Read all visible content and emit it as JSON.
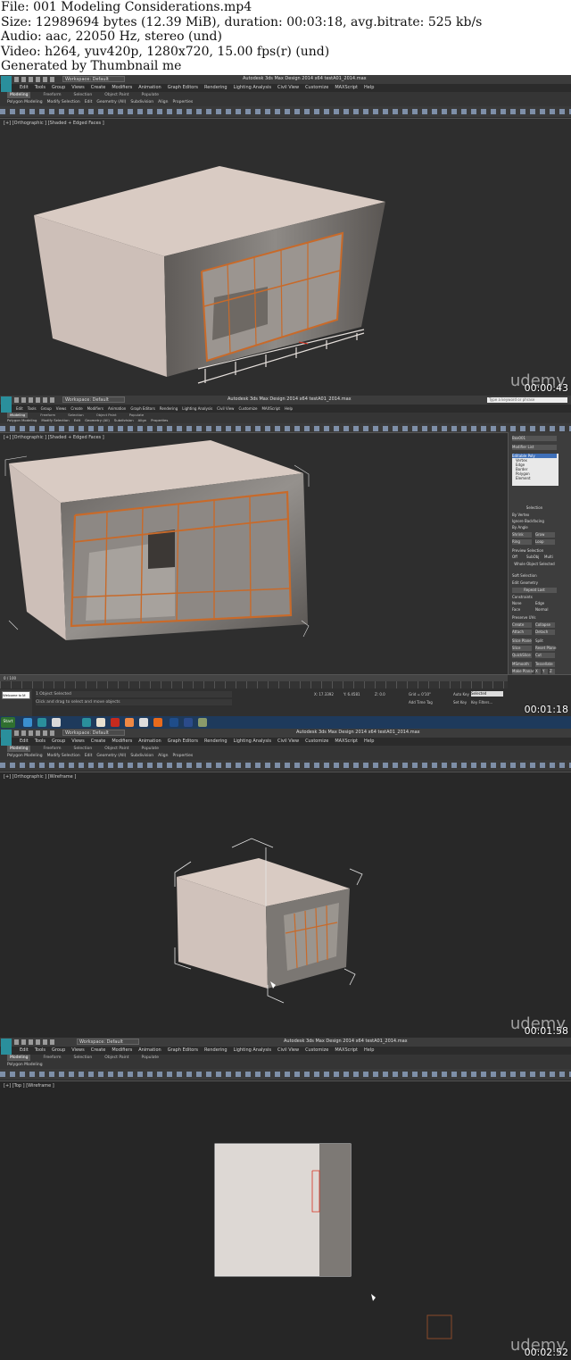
{
  "header": {
    "lines": [
      "File: 001 Modeling Considerations.mp4",
      "Size: 12989694 bytes (12.39 MiB), duration: 00:03:18, avg.bitrate: 525 kb/s",
      "Audio: aac, 22050 Hz, stereo (und)",
      "Video: h264, yuv420p, 1280x720, 15.00 fps(r) (und)",
      "Generated by Thumbnail me"
    ]
  },
  "app": {
    "title": "Autodesk 3ds Max Design 2014 x64     testA01_2014.max",
    "workspace": "Workspace: Default",
    "search_placeholder": "Type a keyword or phrase",
    "menu": [
      "Edit",
      "Tools",
      "Group",
      "Views",
      "Create",
      "Modifiers",
      "Animation",
      "Graph Editors",
      "Rendering",
      "Lighting Analysis",
      "Civil View",
      "Customize",
      "MAXScript",
      "Help"
    ],
    "ribbon_tabs": [
      "Modeling",
      "Freeform",
      "Selection",
      "Object Paint",
      "Populate"
    ],
    "ribbon_sub": [
      "Polygon Modeling",
      "Modify Selection",
      "Edit",
      "Geometry (All)",
      "Subdivision",
      "Align",
      "Properties"
    ],
    "ribbon_sub_short": [
      "Polygon Modeling"
    ],
    "layer": "walls F",
    "selection_set": "Create Selection Se",
    "view_dropdown": "View",
    "filter_dropdown": "All"
  },
  "frames": [
    {
      "viewport_label": "[+] [Orthographic ] [Shaded + Edged Faces ]",
      "timestamp": "00:00:43",
      "watermark": "udemy"
    },
    {
      "viewport_label": "[+] [Orthographic ] [Shaded + Edged Faces ]",
      "timestamp": "00:01:18",
      "watermark": "udemy",
      "command_panel": {
        "object_name": "Box001",
        "modifier_list": "Modifier List",
        "stack": [
          "Editable Poly",
          "Vertex",
          "Edge",
          "Border",
          "Polygon",
          "Element"
        ],
        "rollouts": [
          "Selection",
          "By Vertex",
          "Ignore Backfacing",
          "By Angle",
          "Shrink",
          "Grow",
          "Ring",
          "Loop",
          "Preview Selection",
          "Off",
          "SubObj",
          "Multi",
          "Whole Object Selected",
          "Soft Selection",
          "Edit Geometry",
          "Repeat Last",
          "Constraints",
          "None",
          "Edge",
          "Face",
          "Normal",
          "Preserve UVs",
          "Create",
          "Collapse",
          "Attach",
          "Detach",
          "Slice Plane",
          "Split",
          "Slice",
          "Reset Plane",
          "QuickSlice",
          "Cut",
          "MSmooth",
          "Tessellate",
          "Make Planar",
          "X",
          "Y",
          "Z",
          "View Align",
          "Grid Align",
          "Relax",
          "Hide Selected",
          "Unhide All",
          "Hide Unselected"
        ]
      },
      "status": {
        "selected": "1 Object Selected",
        "prompt": "Click and drag to select and move objects",
        "script_box": "Welcome to M",
        "timeline": "0 / 100",
        "x": "X: 17.3392",
        "y": "Y: 6.4581",
        "z": "Z: 0.0",
        "grid": "Grid = 0'10\"",
        "add_time_tag": "Add Time Tag",
        "auto_key": "Auto Key",
        "set_key": "Set Key",
        "key_filters": "Key Filters...",
        "selected_dropdown": "Selected"
      }
    },
    {
      "viewport_label": "[+] [Orthographic ] [Wireframe ]",
      "timestamp": "00:01:58",
      "watermark": "udemy",
      "taskbar_start": "Start"
    },
    {
      "viewport_label": "[+] [Top ] [Wireframe ]",
      "timestamp": "00:02:52",
      "watermark": "udemy"
    }
  ],
  "colors": {
    "viewport_bg": "#2e2e2e",
    "roof": "#d7c9c1",
    "stone": "#7a7672",
    "frame_orange": "#c86a2a",
    "glass": "#8d8884",
    "wire_white": "#e6e6e6",
    "accent": "#2a8f9c"
  }
}
